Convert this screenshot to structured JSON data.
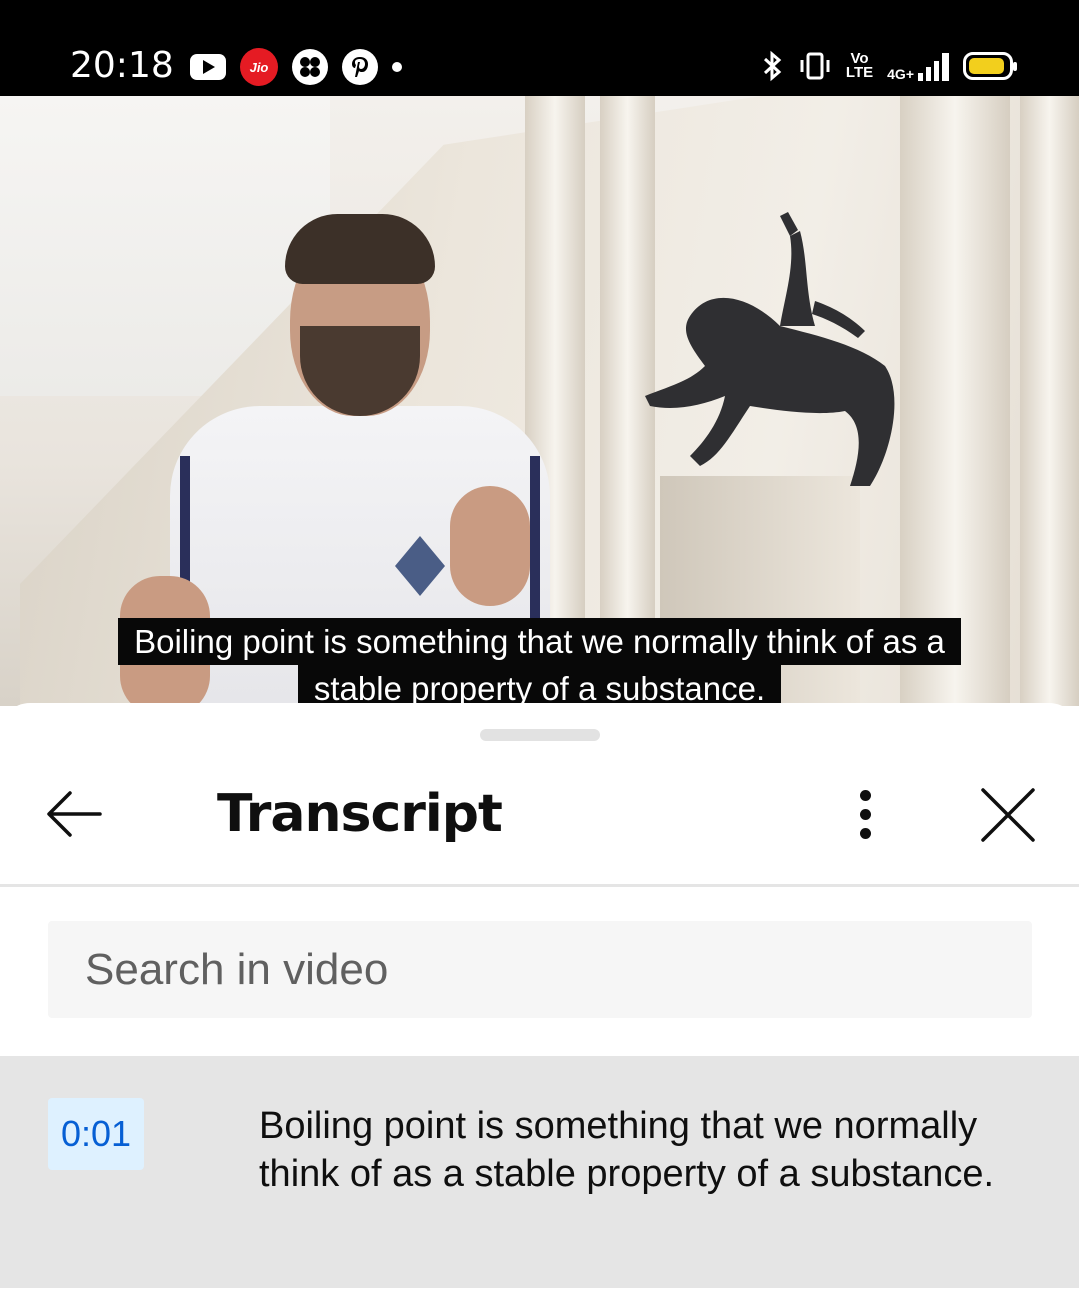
{
  "status_bar": {
    "time": "20:18",
    "left_icons": [
      "youtube-icon",
      "jio-icon",
      "app-icon",
      "pinterest-icon",
      "dot-icon"
    ],
    "jio_label": "Jio",
    "network_label_top": "Vo",
    "network_label_bottom": "LTE",
    "signal_label": "4G+",
    "right_icons": [
      "bluetooth-icon",
      "vibrate-icon",
      "volte-icon",
      "signal-icon",
      "battery-icon"
    ]
  },
  "video": {
    "caption_line1": "Boiling point is something that we normally think of as a",
    "caption_line2": "stable property of a substance."
  },
  "panel": {
    "title": "Transcript",
    "search_placeholder": "Search in video",
    "segments": [
      {
        "timestamp": "0:01",
        "text": "Boiling point is something that we normally think of as a stable property of a substance."
      }
    ]
  },
  "colors": {
    "timestamp_text": "#065fd4",
    "timestamp_bg": "#def1ff",
    "active_segment_bg": "#e5e5e5",
    "battery_fill": "#f2cf1d"
  }
}
